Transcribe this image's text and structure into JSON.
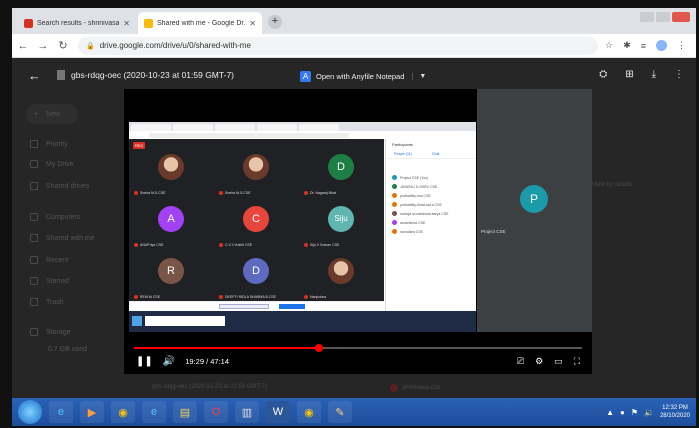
{
  "browser": {
    "tabs": [
      {
        "title": "Search results - shrinivasa.cs@...",
        "active": false
      },
      {
        "title": "Shared with me - Google Dr...",
        "active": true
      }
    ],
    "new_tab_label": "+",
    "url": "drive.google.com/drive/u/0/shared-with-me"
  },
  "drive": {
    "new_label": "New",
    "side_items": [
      "Priority",
      "My Drive",
      "Shared drives",
      "Computers",
      "Shared with me",
      "Recent",
      "Starred",
      "Trash",
      "Storage",
      "0.7 GB used"
    ],
    "right_text": "View by details",
    "bottom_left": "gbs-rdqg-oec (2020-10-23 at 01:59 GMT-7)",
    "bottom_right": "shrinivasa.cse"
  },
  "viewer": {
    "file_name": "gbs-rdqg-oec (2020-10-23 at 01:59 GMT-7)",
    "open_with_label": "Open with Anyfile Notepad",
    "open_with_app_icon": "A"
  },
  "video": {
    "current_time": "19:29",
    "duration": "47:14",
    "time_display": "19:29 / 47:14",
    "progress_fraction": 0.413,
    "rec_label": "REC",
    "right_participant": {
      "initial": "P",
      "name": "Project CSE",
      "color": "#1b9aaa"
    },
    "tiles": [
      {
        "initial": "",
        "photo": true,
        "name": "Sneha M.S.CSE",
        "color": "#6a3a2a"
      },
      {
        "initial": "",
        "photo": true,
        "name": "Sneha M.S.CSE",
        "color": "#6a3a2a"
      },
      {
        "initial": "D",
        "photo": false,
        "name": "Dr. Nagaraj Bhat",
        "color": "#1e7e45"
      },
      {
        "initial": "A",
        "photo": false,
        "name": "ANUPriya CSE",
        "color": "#a142f4"
      },
      {
        "initial": "C",
        "photo": false,
        "name": "C.V.Y.Vrishti CSE",
        "color": "#e8453c"
      },
      {
        "initial": "Siju",
        "photo": false,
        "name": "Siju V Soman CSE",
        "color": "#5fb5b0"
      },
      {
        "initial": "R",
        "photo": false,
        "name": "REKHA CSE",
        "color": "#795548"
      },
      {
        "initial": "D",
        "photo": false,
        "name": "DEEPTI RIDLA SHARMA B.CSE",
        "color": "#5c6bc0"
      },
      {
        "initial": "",
        "photo": true,
        "name": "Nanjudara",
        "color": "#6a3a2a"
      }
    ],
    "panel_title": "Participants",
    "panel_tabs": [
      "People (11)",
      "Chat"
    ],
    "panel_rows": [
      {
        "name": "Project CSE (You)",
        "color": "#1b9aaa"
      },
      {
        "name": "JAYARAJ D.SHRV CSE",
        "color": "#1e7e45"
      },
      {
        "name": "probability-ess CSE",
        "color": "#e8710a"
      },
      {
        "name": "probability-bhaa.sat-a CSE",
        "color": "#e8710a"
      },
      {
        "name": "mahcja.scodeshwar.sarya CSE",
        "color": "#795548"
      },
      {
        "name": "anukrishna CSE",
        "color": "#a142f4"
      },
      {
        "name": "nanudara CSE",
        "color": "#e8710a"
      }
    ]
  },
  "taskbar": {
    "apps": [
      "ie",
      "media",
      "chrome",
      "edge",
      "explorer",
      "opera",
      "notepad",
      "word",
      "chrome2",
      "paint"
    ],
    "time": "12:32 PM",
    "date": "28/10/2020"
  }
}
